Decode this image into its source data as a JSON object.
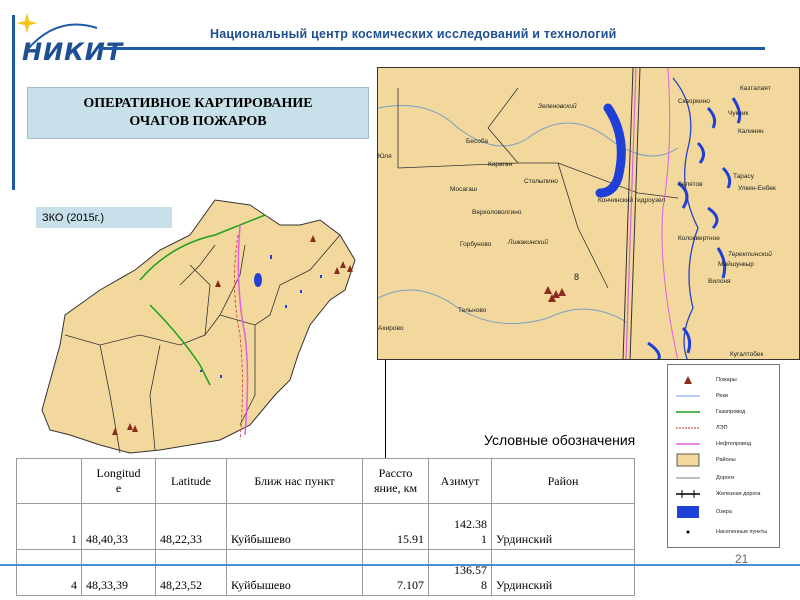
{
  "header": {
    "org_title": "Национальный центр космических исследований и технологий",
    "logo_text": "НИКИТ"
  },
  "title": {
    "text": "ОПЕРАТИВНОЕ КАРТИРОВАНИЕ\nОЧАГОВ ПОЖАРОВ"
  },
  "region": {
    "label": "ЗКО (2015г.)"
  },
  "big_map": {
    "places": [
      "Зеленовский",
      "Бесоба",
      "Караган",
      "Столыпино",
      "Мосагаш",
      "Верхоловолгино",
      "Горбуново",
      "Лижакинский",
      "Тельново",
      "Кончинский гидроузел",
      "Скворкино",
      "Чукчик",
      "Казталаят",
      "Калинин",
      "Тарасу",
      "Улкен-Енбек",
      "Теректинский",
      "Колоквертное",
      "Майшункыр",
      "Кугалтобек",
      "Юля",
      "Ахирово",
      "Зелятов",
      "Вилоня"
    ],
    "label_8": "8"
  },
  "legend": {
    "caption": "Условные обозначения",
    "items": [
      "Пожары",
      "Реки",
      "Газопровод",
      "ЛЭП",
      "Нефтепровод",
      "Районы",
      "Дороги",
      "Железная дорога",
      "Озера",
      "Населенные пункты"
    ]
  },
  "table": {
    "headers": [
      "",
      "Longitude",
      "Latitude",
      "Ближ нас пункт",
      "Расстояние, км",
      "Азимут",
      "Район"
    ],
    "header_display": [
      "",
      "Longitud\ne",
      "Latitude",
      "Ближ нас пункт",
      "Рассто\nяние, км",
      "Азимут",
      "Район"
    ],
    "rows": [
      {
        "n": "1",
        "lon": "48,40,33",
        "lat": "48,22,33",
        "place": "Куйбышево",
        "dist": "15.91",
        "az": "142.38\n1",
        "district": "Урдинский"
      },
      {
        "n": "4",
        "lon": "48,33,39",
        "lat": "48,23,52",
        "place": "Куйбышево",
        "dist": "7.107",
        "az": "136.57\n8",
        "district": "Урдинский"
      }
    ]
  },
  "page": {
    "number": "21"
  },
  "colors": {
    "accent": "#1f5aa6",
    "title_box": "#c8e0ea",
    "map_fill": "#f2d89c",
    "fire": "#8b2b1e",
    "river": "#3355ff",
    "gas": "#1aa01a",
    "oil": "#e060e0",
    "lake": "#1f3fd6"
  }
}
